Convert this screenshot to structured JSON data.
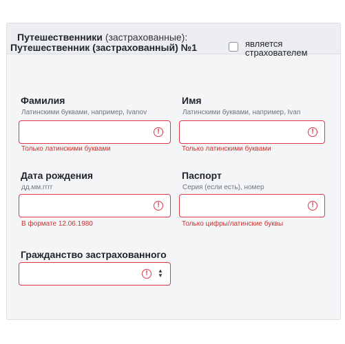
{
  "section": {
    "title_main": "Путешественники",
    "title_sub": "(застрахованные):"
  },
  "traveler": {
    "title": "Путешественник (застрахованный) №1",
    "is_insurer_label_line1": "является",
    "is_insurer_label_line2": "страхователем",
    "is_insurer_checked": false
  },
  "fields": {
    "surname": {
      "label": "Фамилия",
      "hint": "Латинскими буквами, например, Ivanov",
      "value": "",
      "error": "Только латинскими буквами"
    },
    "name": {
      "label": "Имя",
      "hint": "Латинскими буквами, например, Ivan",
      "value": "",
      "error": "Только латинскими буквами"
    },
    "birthdate": {
      "label": "Дата рождения",
      "hint": "дд.мм.гггг",
      "value": "",
      "error": "В формате 12.06.1980"
    },
    "passport": {
      "label": "Паспорт",
      "hint": "Серия (если есть), номер",
      "value": "",
      "error": "Только цифры/латинские буквы"
    },
    "citizenship": {
      "label": "Гражданство застрахованного",
      "value": ""
    }
  },
  "icons": {
    "error": "error-circle-icon",
    "select": "select-arrows-icon"
  },
  "colors": {
    "error": "#dc3545",
    "error_text": "#c9302c",
    "hint": "#6c757d",
    "card_bg": "#f4f5f7",
    "header_bg": "#eceef1"
  }
}
